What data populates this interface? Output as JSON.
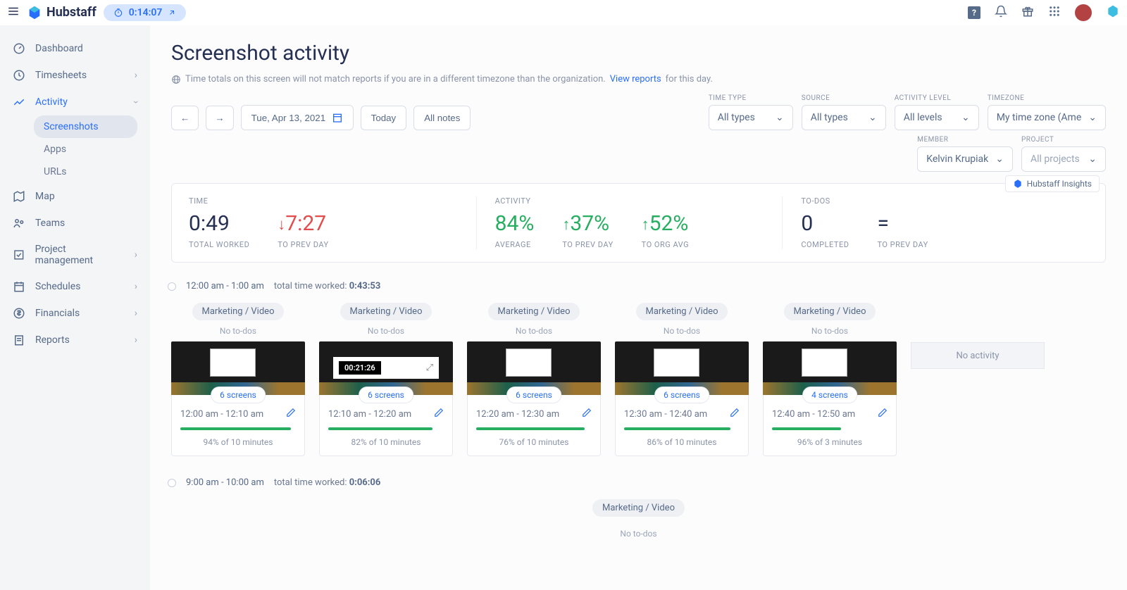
{
  "brand": "Hubstaff",
  "timer": "0:14:07",
  "sidebar": {
    "items": [
      {
        "label": "Dashboard"
      },
      {
        "label": "Timesheets"
      },
      {
        "label": "Activity",
        "active": true,
        "subs": [
          {
            "label": "Screenshots",
            "active": true
          },
          {
            "label": "Apps"
          },
          {
            "label": "URLs"
          }
        ]
      },
      {
        "label": "Map"
      },
      {
        "label": "Teams"
      },
      {
        "label": "Project management"
      },
      {
        "label": "Schedules"
      },
      {
        "label": "Financials"
      },
      {
        "label": "Reports"
      }
    ]
  },
  "page": {
    "title": "Screenshot activity",
    "note_pre": "Time totals on this screen will not match reports if you are in a different timezone than the organization.",
    "note_link": "View reports",
    "note_post": "for this day.",
    "date": "Tue, Apr 13, 2021",
    "today_btn": "Today",
    "allnotes_btn": "All notes"
  },
  "filters": {
    "time_type": {
      "label": "TIME TYPE",
      "value": "All types"
    },
    "source": {
      "label": "SOURCE",
      "value": "All types"
    },
    "activity_level": {
      "label": "ACTIVITY LEVEL",
      "value": "All levels"
    },
    "timezone": {
      "label": "TIMEZONE",
      "value": "My time zone (Ame"
    },
    "member": {
      "label": "MEMBER",
      "value": "Kelvin Krupiak"
    },
    "project": {
      "label": "PROJECT",
      "value": "All projects"
    }
  },
  "insights_badge": "Hubstaff Insights",
  "stats": {
    "time": {
      "head": "TIME",
      "total": "0:49",
      "total_sub": "TOTAL WORKED",
      "prev": "7:27",
      "prev_sub": "TO PREV DAY"
    },
    "activity": {
      "head": "ACTIVITY",
      "avg": "84%",
      "avg_sub": "AVERAGE",
      "prev": "37%",
      "prev_sub": "TO PREV DAY",
      "org": "52%",
      "org_sub": "TO ORG AVG"
    },
    "todos": {
      "head": "TO-DOS",
      "completed": "0",
      "completed_sub": "COMPLETED",
      "prev": "=",
      "prev_sub": "TO PREV DAY"
    }
  },
  "block1": {
    "range": "12:00 am - 1:00 am",
    "total_label": "total time worked:",
    "total": "0:43:53",
    "no_activity_label": "No activity",
    "cards": [
      {
        "tag": "Marketing / Video",
        "todos": "No to-dos",
        "screens": "6 screens",
        "time": "12:00 am - 12:10 am",
        "pct": "94% of 10 minutes",
        "pw": 96,
        "thumb_overlay": ""
      },
      {
        "tag": "Marketing / Video",
        "todos": "No to-dos",
        "screens": "6 screens",
        "time": "12:10 am - 12:20 am",
        "pct": "82% of 10 minutes",
        "pw": 90,
        "thumb_overlay": "00:21:26"
      },
      {
        "tag": "Marketing / Video",
        "todos": "No to-dos",
        "screens": "6 screens",
        "time": "12:20 am - 12:30 am",
        "pct": "76% of 10 minutes",
        "pw": 94,
        "thumb_overlay": ""
      },
      {
        "tag": "Marketing / Video",
        "todos": "No to-dos",
        "screens": "6 screens",
        "time": "12:30 am - 12:40 am",
        "pct": "86% of 10 minutes",
        "pw": 92,
        "thumb_overlay": ""
      },
      {
        "tag": "Marketing / Video",
        "todos": "No to-dos",
        "screens": "4 screens",
        "time": "12:40 am - 12:50 am",
        "pct": "96% of 3 minutes",
        "pw": 60,
        "thumb_overlay": ""
      }
    ]
  },
  "block2": {
    "range": "9:00 am - 10:00 am",
    "total_label": "total time worked:",
    "total": "0:06:06",
    "tag": "Marketing / Video",
    "todos": "No to-dos"
  }
}
